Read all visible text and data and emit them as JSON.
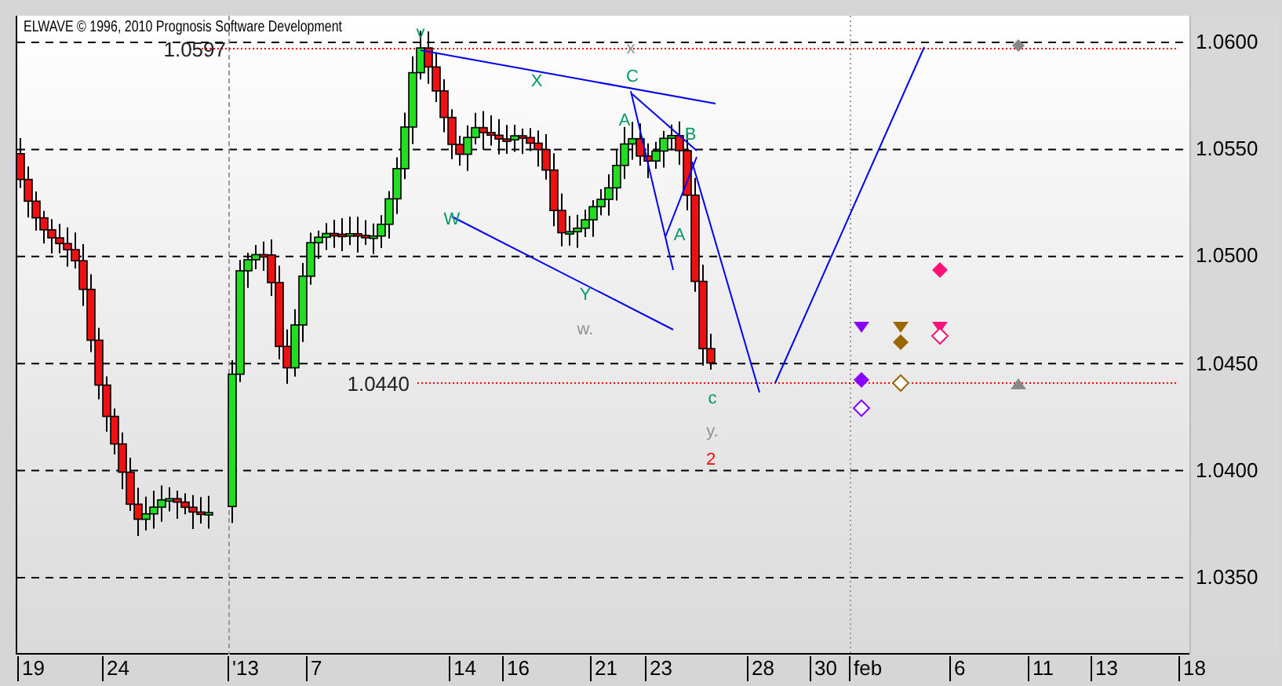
{
  "title": "ELWAVE © 1996, 2010 Prognosis Software Development",
  "price_axis": [
    "1.0600",
    "1.0550",
    "1.0500",
    "1.0450",
    "1.0400",
    "1.0350"
  ],
  "date_axis": [
    "19",
    "24",
    "'13",
    "7",
    "14",
    "16",
    "21",
    "23",
    "28",
    "30",
    "feb",
    "6",
    "11",
    "13",
    "18"
  ],
  "price_markers": [
    {
      "label": "1.0597"
    },
    {
      "label": "1.0440"
    }
  ],
  "wave_labels": [
    {
      "text": "v",
      "color": "#009966"
    },
    {
      "text": "x",
      "color": "#909090"
    },
    {
      "text": "X",
      "color": "#009966"
    },
    {
      "text": "C",
      "color": "#009966"
    },
    {
      "text": "A",
      "color": "#009966"
    },
    {
      "text": "B",
      "color": "#009966"
    },
    {
      "text": "W",
      "color": "#009966"
    },
    {
      "text": "A",
      "color": "#009966"
    },
    {
      "text": "Y",
      "color": "#009966"
    },
    {
      "text": "w.",
      "color": "#909090"
    },
    {
      "text": "c",
      "color": "#009966"
    },
    {
      "text": "y.",
      "color": "#909090"
    },
    {
      "text": "2",
      "color": "#ff0000"
    }
  ]
}
